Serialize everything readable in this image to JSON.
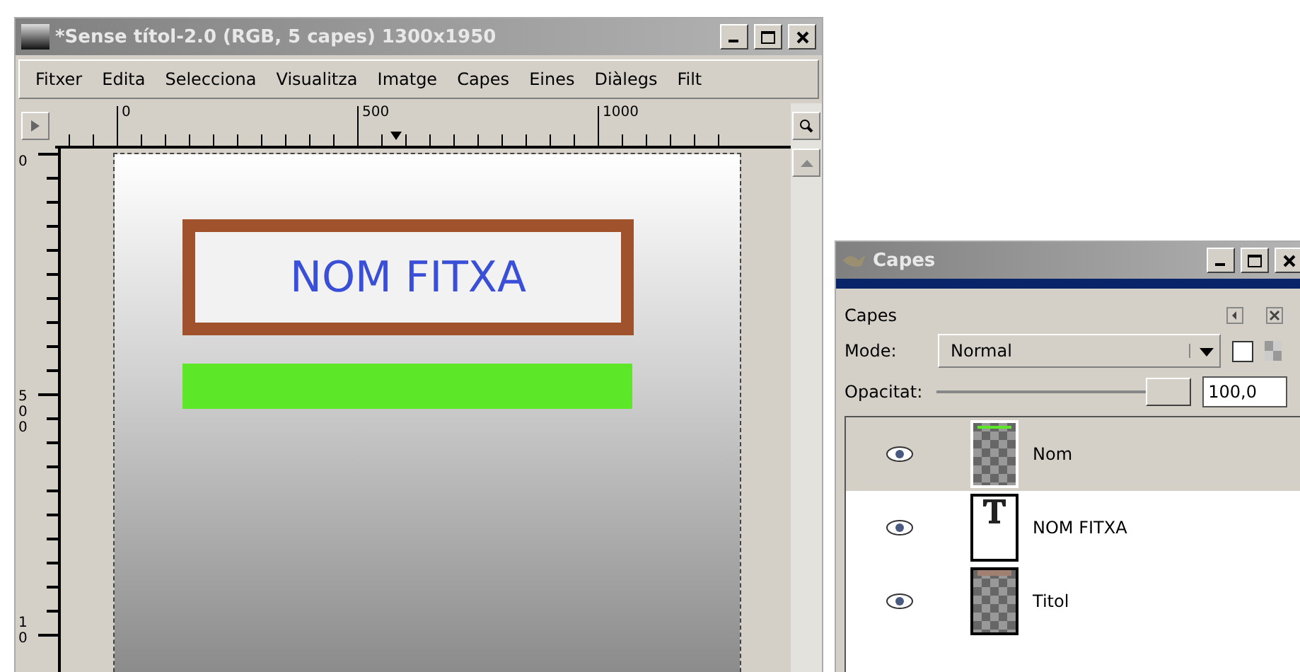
{
  "image_window": {
    "title": "*Sense títol-2.0 (RGB, 5 capes) 1300x1950",
    "menu": [
      "Fitxer",
      "Edita",
      "Selecciona",
      "Visualitza",
      "Imatge",
      "Capes",
      "Eines",
      "Diàlegs",
      "Filt"
    ],
    "hruler_labels": [
      "0",
      "500",
      "1000"
    ],
    "vruler_labels": [
      "0",
      "500",
      "10"
    ],
    "canvas": {
      "title_text": "NOM FITXA"
    }
  },
  "layers_dialog": {
    "title": "Capes",
    "section": "Capes",
    "mode_label": "Mode:",
    "mode_value": "Normal",
    "lock_alpha": {
      "checked": false
    },
    "opacity_label": "Opacitat:",
    "opacity": {
      "level": 1.0,
      "reading": "100,0"
    },
    "layers": [
      {
        "name": "Nom",
        "kind": "green",
        "visible": true,
        "selected": true
      },
      {
        "name": "NOM FITXA",
        "kind": "text",
        "visible": true,
        "selected": false
      },
      {
        "name": "Titol",
        "kind": "frame",
        "visible": true,
        "selected": false
      }
    ]
  }
}
